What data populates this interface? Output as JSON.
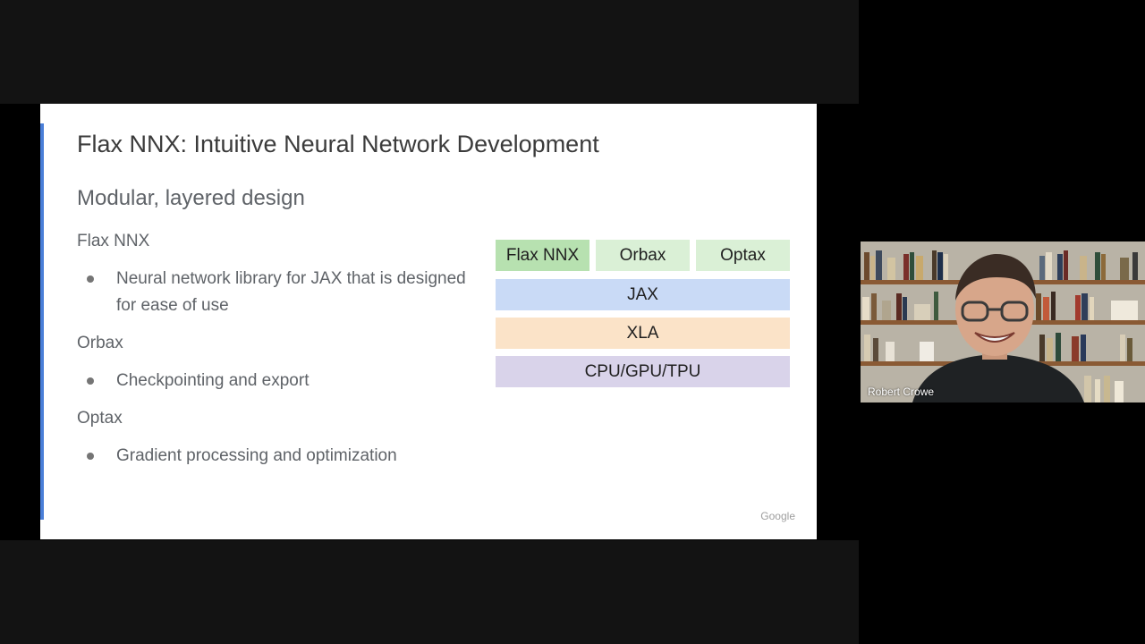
{
  "slide": {
    "title": "Flax NNX: Intuitive Neural Network Development",
    "subtitle": "Modular, layered design",
    "sections": [
      {
        "label": "Flax NNX",
        "bullet": "Neural network library for JAX that is designed for ease of use"
      },
      {
        "label": "Orbax",
        "bullet": "Checkpointing and export"
      },
      {
        "label": "Optax",
        "bullet": "Gradient processing and optimization"
      }
    ],
    "stack": {
      "top": [
        "Flax NNX",
        "Orbax",
        "Optax"
      ],
      "layers": [
        "JAX",
        "XLA",
        "CPU/GPU/TPU"
      ]
    },
    "logo_text": "Google"
  },
  "colors": {
    "accent": "#4a7fd8",
    "flax_nnx": "#b7e1b0",
    "orbax_optax": "#daf0d6",
    "jax": "#c9daf6",
    "xla": "#fbe3c8",
    "hardware": "#d9d3ea"
  },
  "participant": {
    "name": "Robert Crowe"
  }
}
